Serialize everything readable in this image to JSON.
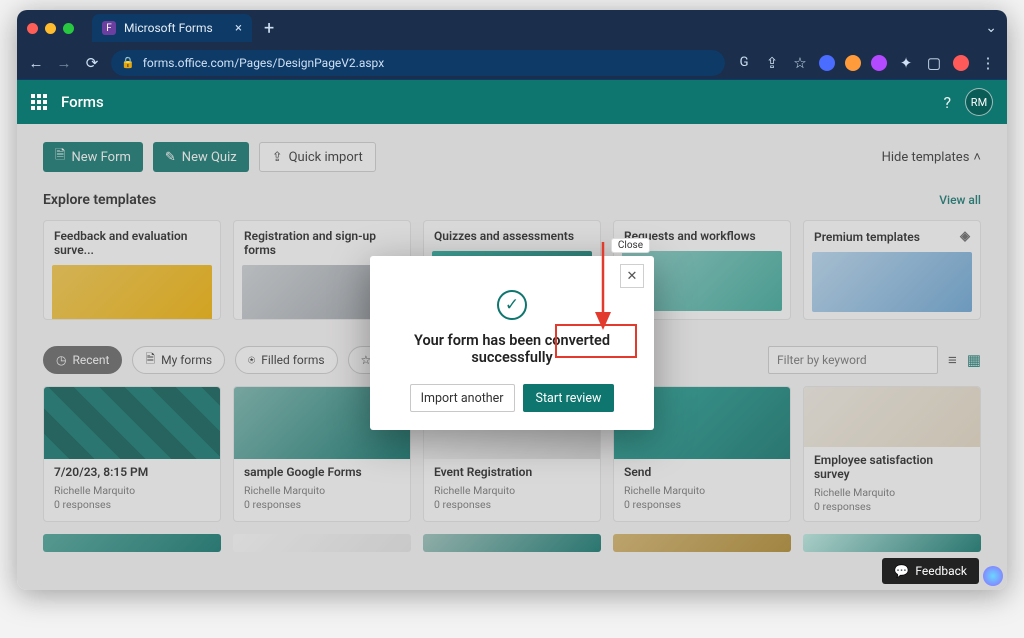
{
  "browser": {
    "tab_title": "Microsoft Forms",
    "url": "forms.office.com/Pages/DesignPageV2.aspx"
  },
  "app": {
    "name": "Forms",
    "avatar_initials": "RM"
  },
  "toolbar": {
    "new_form": "New Form",
    "new_quiz": "New Quiz",
    "quick_import": "Quick import",
    "hide_templates": "Hide templates"
  },
  "templates": {
    "heading": "Explore templates",
    "view_all": "View all",
    "items": [
      {
        "title": "Feedback and evaluation surve..."
      },
      {
        "title": "Registration and sign-up forms"
      },
      {
        "title": "Quizzes and assessments"
      },
      {
        "title": "Requests and workflows"
      },
      {
        "title": "Premium templates"
      }
    ]
  },
  "filters": {
    "recent": "Recent",
    "my_forms": "My forms",
    "filled_forms": "Filled forms",
    "favorites": "Favorit",
    "search_placeholder": "Filter by keyword"
  },
  "cards": [
    {
      "title": "7/20/23, 8:15 PM",
      "author": "Richelle Marquito",
      "resp": "0 responses"
    },
    {
      "title": "sample Google Forms",
      "author": "Richelle Marquito",
      "resp": "0 responses"
    },
    {
      "title": "Event Registration",
      "author": "Richelle Marquito",
      "resp": "0 responses"
    },
    {
      "title": "Send",
      "author": "Richelle Marquito",
      "resp": "0 responses"
    },
    {
      "title": "Employee satisfaction survey",
      "author": "Richelle Marquito",
      "resp": "0 responses"
    }
  ],
  "modal": {
    "close_tip": "Close",
    "message": "Your form has been converted successfully",
    "import_another": "Import another",
    "start_review": "Start review"
  },
  "feedback": {
    "label": "Feedback"
  }
}
